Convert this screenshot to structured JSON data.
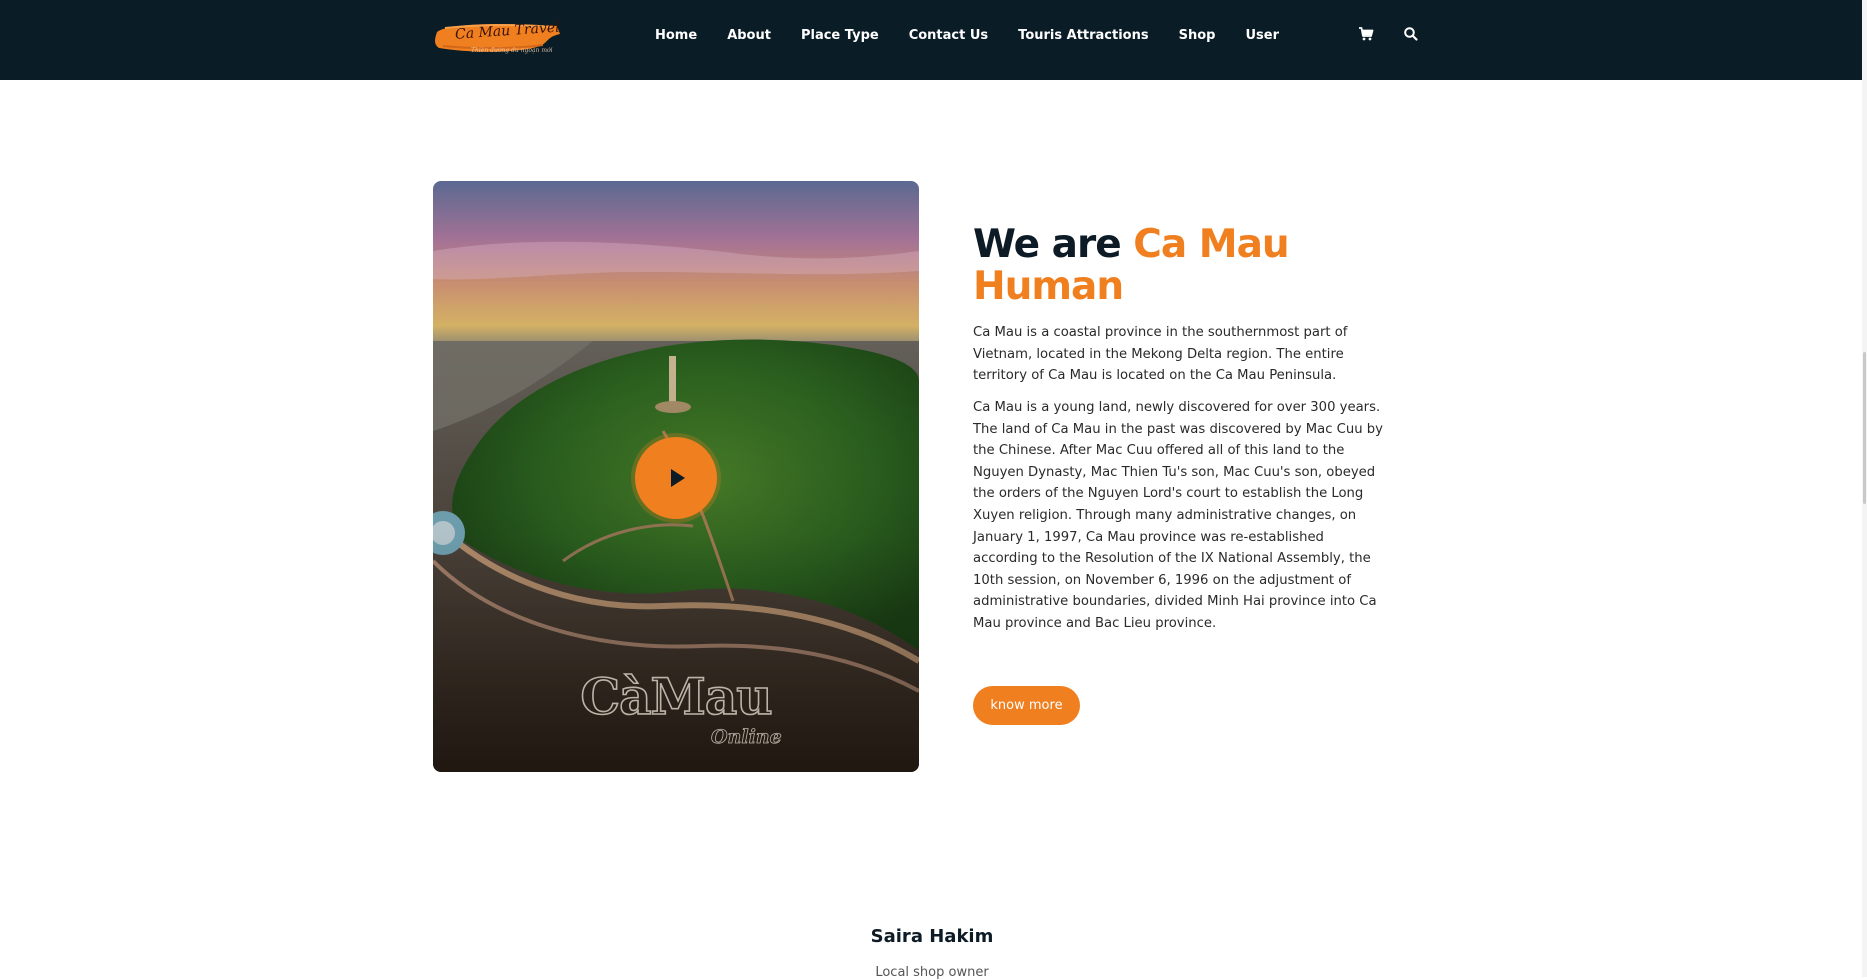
{
  "header": {
    "logo": {
      "title": "Ca Mau Travel",
      "tagline": "Thiên đường du ngoạn mới"
    },
    "nav_items": [
      {
        "label": "Home"
      },
      {
        "label": "About"
      },
      {
        "label": "Place Type"
      },
      {
        "label": "Contact Us"
      },
      {
        "label": "Touris Attractions"
      },
      {
        "label": "Shop"
      },
      {
        "label": "User"
      }
    ],
    "icons": [
      "cart-icon",
      "search-icon"
    ]
  },
  "about": {
    "video": {
      "watermark": "CàMau",
      "watermark_sub": "Online",
      "play_icon": "play-icon"
    },
    "headline_plain": "We are ",
    "headline_accent": "Ca Mau Human",
    "paragraph_1": "Ca Mau is a coastal province in the southernmost part of Vietnam, located in the Mekong Delta region. The entire territory of Ca Mau is located on the Ca Mau Peninsula.",
    "paragraph_2": "Ca Mau is a young land, newly discovered for over 300 years. The land of Ca Mau in the past was discovered by Mac Cuu by the Chinese. After Mac Cuu offered all of this land to the Nguyen Dynasty, Mac Thien Tu's son, Mac Cuu's son, obeyed the orders of the Nguyen Lord's court to establish the Long Xuyen religion. Through many administrative changes, on January 1, 1997, Ca Mau province was re-established according to the Resolution of the IX National Assembly, the 10th session, on November 6, 1996 on the adjustment of administrative boundaries, divided Minh Hai province into Ca Mau province and Bac Lieu province.",
    "button_label": "know more"
  },
  "testimonial": {
    "name": "Saira Hakim",
    "role": "Local shop owner"
  },
  "colors": {
    "nav_background": "#0a1c26",
    "accent": "#f07f1f",
    "heading_dark": "#0d1b26"
  }
}
